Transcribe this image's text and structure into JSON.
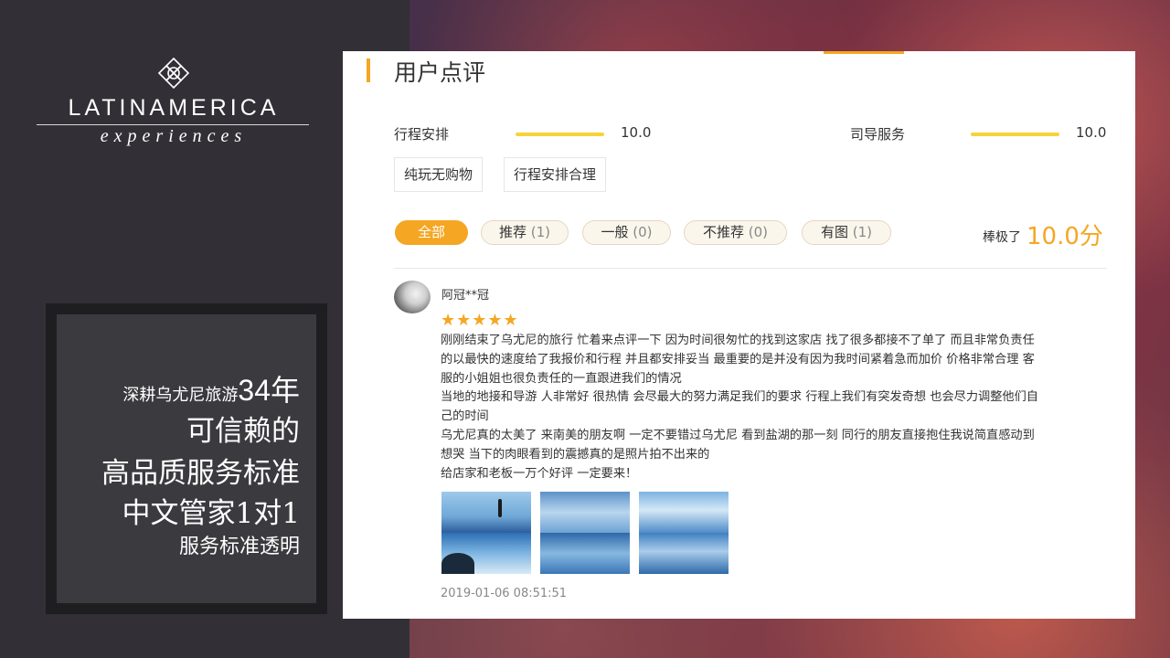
{
  "brand": {
    "main": "LATINAMERICA",
    "sub": "experiences"
  },
  "slogan": {
    "line1_small": "深耕乌尤尼旅游",
    "line1_big": "34年",
    "line2": "可信赖的",
    "line3": "高品质服务标准",
    "line4": "中文管家1对1",
    "line5": "服务标准透明"
  },
  "reviews_section": {
    "title": "用户点评",
    "ratings": [
      {
        "label": "行程安排",
        "value": "10.0"
      },
      {
        "label": "司导服务",
        "value": "10.0"
      }
    ],
    "tags": [
      "纯玩无购物",
      "行程安排合理"
    ],
    "filters": [
      {
        "label": "全部",
        "count": "",
        "active": true
      },
      {
        "label": "推荐",
        "count": "(1)",
        "active": false
      },
      {
        "label": "一般",
        "count": "(0)",
        "active": false
      },
      {
        "label": "不推荐",
        "count": "(0)",
        "active": false
      },
      {
        "label": "有图",
        "count": "(1)",
        "active": false
      }
    ],
    "score_label": "棒极了",
    "score_value": "10.0分",
    "review": {
      "username": "阿冠**冠",
      "stars": "★★★★★",
      "rating_out_of_5": 5,
      "lines": [
        "刚刚结束了乌尤尼的旅行 忙着来点评一下 因为时间很匆忙的找到这家店 找了很多都接不了单了 而且非常负责任",
        "的以最快的速度给了我报价和行程 并且都安排妥当 最重要的是并没有因为我时间紧着急而加价 价格非常合理 客",
        "服的小姐姐也很负责任的一直跟进我们的情况",
        "当地的地接和导游 人非常好 很热情 会尽最大的努力满足我们的要求 行程上我们有突发奇想 也会尽力调整他们自",
        "己的时间",
        "乌尤尼真的太美了 来南美的朋友啊 一定不要错过乌尤尼 看到盐湖的那一刻 同行的朋友直接抱住我说简直感动到",
        "想哭 当下的肉眼看到的震撼真的是照片拍不出来的",
        "给店家和老板一万个好评 一定要来！"
      ],
      "timestamp": "2019-01-06 08:51:51"
    }
  },
  "colors": {
    "accent": "#f5a623",
    "rating_bar": "#f8d23a",
    "left_panel": "#323036"
  }
}
